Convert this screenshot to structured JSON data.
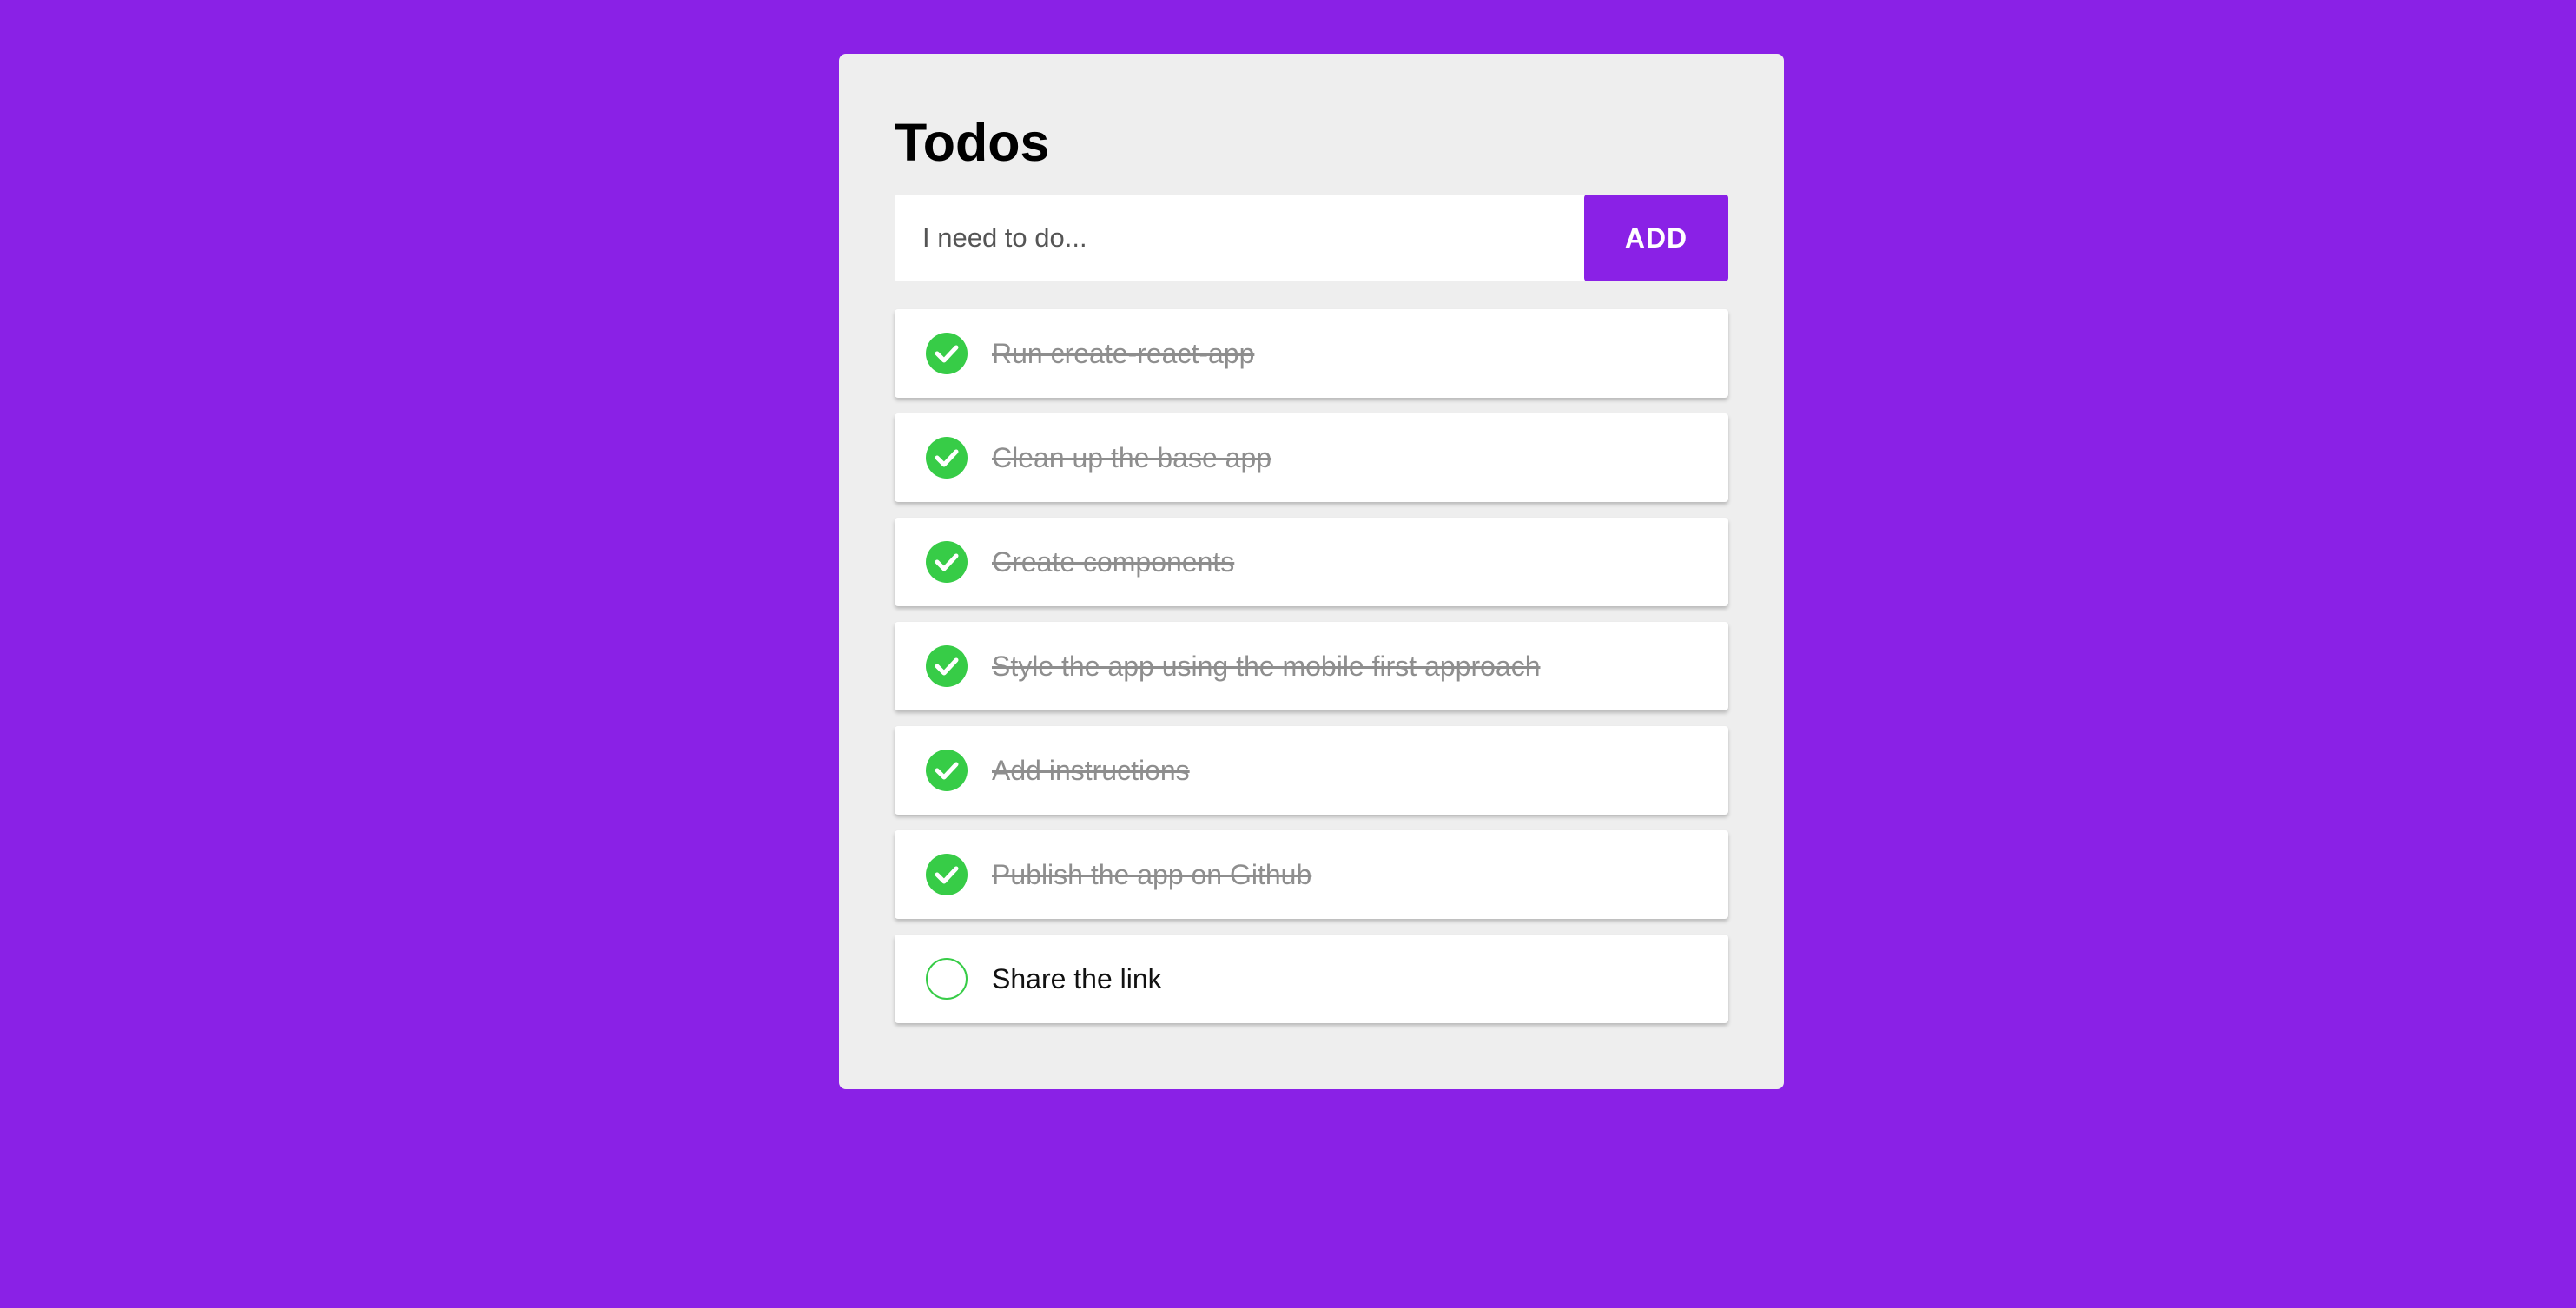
{
  "app": {
    "title": "Todos",
    "accent_color": "#8A21E6",
    "check_color": "#37CC47"
  },
  "add_form": {
    "placeholder": "I need to do...",
    "value": "",
    "button_label": "ADD"
  },
  "todos": [
    {
      "text": "Run create-react-app",
      "done": true
    },
    {
      "text": "Clean up the base app",
      "done": true
    },
    {
      "text": "Create components",
      "done": true
    },
    {
      "text": "Style the app using the mobile first approach",
      "done": true
    },
    {
      "text": "Add instructions",
      "done": true
    },
    {
      "text": "Publish the app on Github",
      "done": true
    },
    {
      "text": "Share the link",
      "done": false
    }
  ],
  "icons": {
    "done": "check-circle-icon",
    "open": "empty-circle-icon"
  }
}
